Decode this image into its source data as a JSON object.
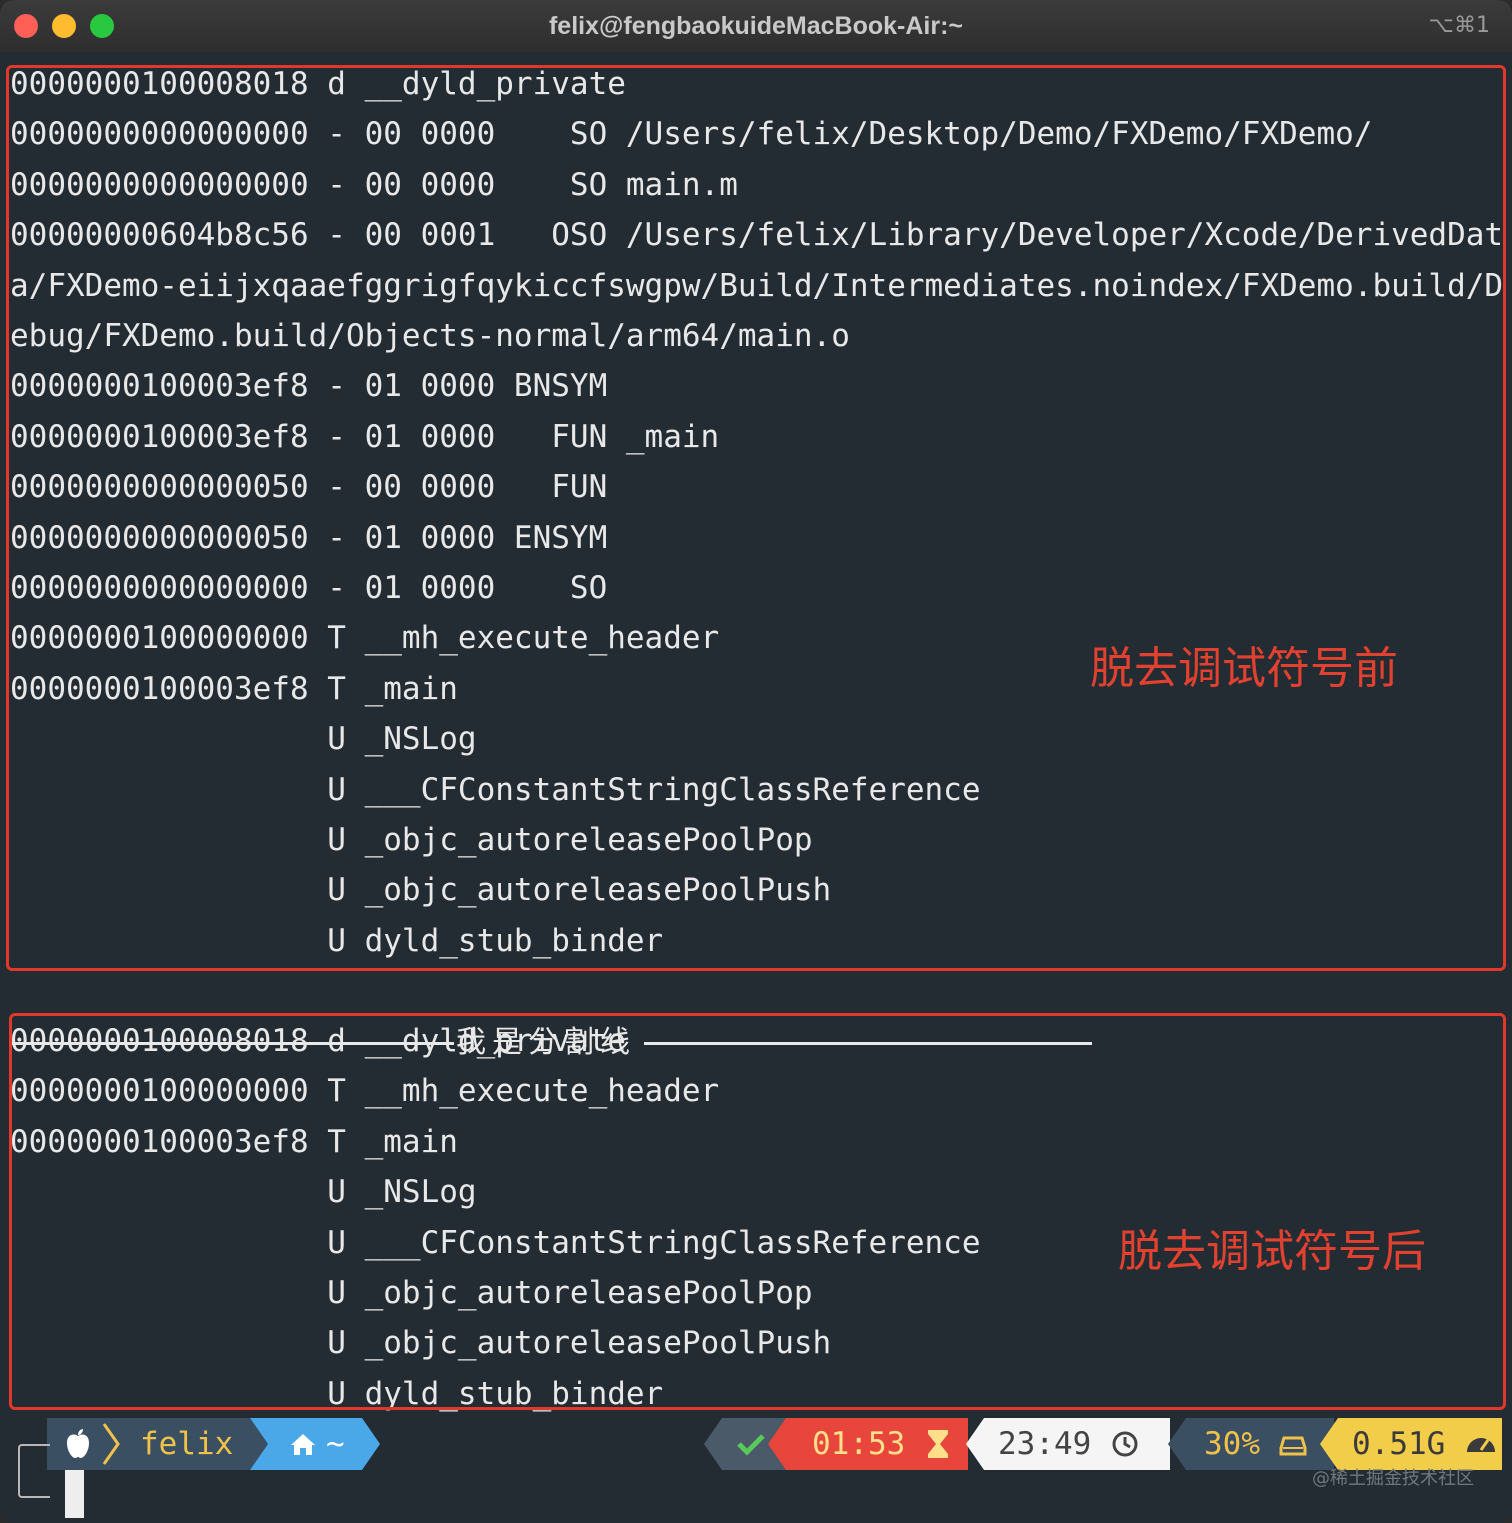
{
  "window": {
    "title": "felix@fengbaokuideMacBook-Air:~",
    "shortcut": "⌥⌘1"
  },
  "terminal": {
    "before_lines": [
      "0000000100008018 d __dyld_private",
      "0000000000000000 - 00 0000    SO /Users/felix/Desktop/Demo/FXDemo/FXDemo/",
      "0000000000000000 - 00 0000    SO main.m",
      "00000000604b8c56 - 00 0001   OSO /Users/felix/Library/Developer/Xcode/DerivedDat",
      "a/FXDemo-eiijxqaaefggrigfqykiccfswgpw/Build/Intermediates.noindex/FXDemo.build/D",
      "ebug/FXDemo.build/Objects-normal/arm64/main.o",
      "0000000100003ef8 - 01 0000 BNSYM",
      "0000000100003ef8 - 01 0000   FUN _main",
      "0000000000000050 - 00 0000   FUN",
      "0000000000000050 - 01 0000 ENSYM",
      "0000000000000000 - 01 0000    SO",
      "0000000100000000 T __mh_execute_header",
      "0000000100003ef8 T _main",
      "                 U _NSLog",
      "                 U ___CFConstantStringClassReference",
      "                 U _objc_autoreleasePoolPop",
      "                 U _objc_autoreleasePoolPush",
      "                 U dyld_stub_binder"
    ],
    "divider": "我是分割线",
    "after_lines": [
      "0000000100008018 d __dyld_private",
      "0000000100000000 T __mh_execute_header",
      "0000000100003ef8 T _main",
      "                 U _NSLog",
      "                 U ___CFConstantStringClassReference",
      "                 U _objc_autoreleasePoolPop",
      "                 U _objc_autoreleasePoolPush",
      "                 U dyld_stub_binder"
    ]
  },
  "annotations": {
    "before": "脱去调试符号前",
    "after": "脱去调试符号后"
  },
  "prompt": {
    "user": "felix",
    "dir": "~",
    "elapsed": "01:53",
    "clock": "23:49",
    "battery": "30%",
    "memory": "0.51G"
  },
  "icons": [
    "apple-icon",
    "home-icon",
    "check-icon",
    "hourglass-icon",
    "clock-icon",
    "battery-icon",
    "gauge-icon"
  ],
  "watermark": "@稀土掘金技术社区",
  "colors": {
    "background": "#242c33",
    "annotation": "#e2412f",
    "seg_user": "#3b4f63",
    "seg_dir": "#4aa8e8",
    "seg_status": "#4a5a68",
    "seg_elapsed": "#e8453c",
    "seg_clock": "#f5f5f5",
    "seg_battery": "#3b4f63",
    "seg_memory": "#f2cd4a"
  }
}
